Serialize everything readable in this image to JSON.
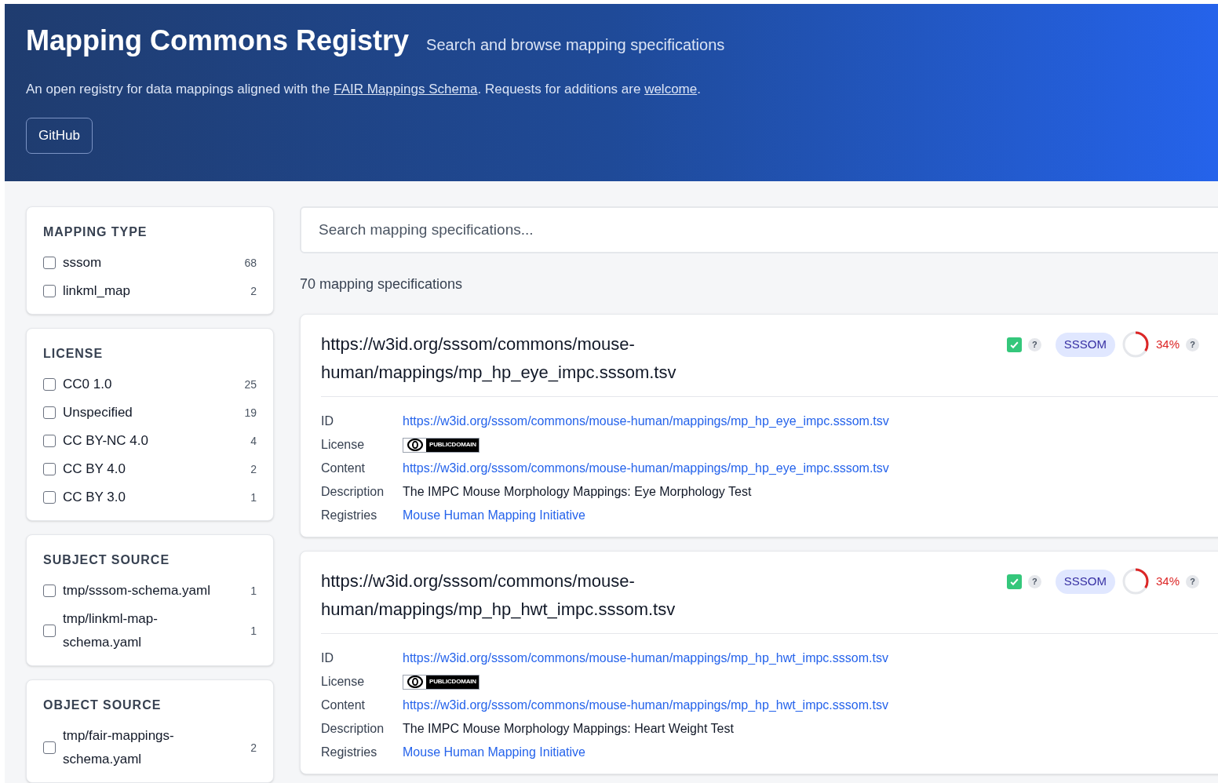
{
  "header": {
    "title": "Mapping Commons Registry",
    "subtitle": "Search and browse mapping specifications",
    "intro": [
      {
        "kind": "text",
        "text": "An open registry for data mappings aligned with the "
      },
      {
        "kind": "link",
        "text": "FAIR Mappings Schema"
      },
      {
        "kind": "text",
        "text": ". Requests for additions are "
      },
      {
        "kind": "link",
        "text": "welcome"
      },
      {
        "kind": "text",
        "text": "."
      }
    ],
    "button": "GitHub"
  },
  "filters": [
    {
      "title": "MAPPING TYPE",
      "options": [
        {
          "label": "sssom",
          "count": "68",
          "checked": false
        },
        {
          "label": "linkml_map",
          "count": "2",
          "checked": false
        }
      ]
    },
    {
      "title": "LICENSE",
      "options": [
        {
          "label": "CC0 1.0",
          "count": "25",
          "checked": false
        },
        {
          "label": "Unspecified",
          "count": "19",
          "checked": false
        },
        {
          "label": "CC BY-NC 4.0",
          "count": "4",
          "checked": false
        },
        {
          "label": "CC BY 4.0",
          "count": "2",
          "checked": false
        },
        {
          "label": "CC BY 3.0",
          "count": "1",
          "checked": false
        }
      ]
    },
    {
      "title": "SUBJECT SOURCE",
      "options": [
        {
          "label": "tmp/sssom-schema.yaml",
          "count": "1",
          "checked": false
        },
        {
          "label": "tmp/linkml-map-schema.yaml",
          "count": "1",
          "checked": false
        }
      ]
    },
    {
      "title": "OBJECT SOURCE",
      "options": [
        {
          "label": "tmp/fair-mappings-schema.yaml",
          "count": "2",
          "checked": false
        }
      ]
    }
  ],
  "search": {
    "placeholder": "Search mapping specifications..."
  },
  "result_count": "70 mapping specifications",
  "results": [
    {
      "title": "https://w3id.org/sssom/commons/mouse-human/mappings/mp_hp_eye_impc.sssom.tsv",
      "valid": true,
      "valid_help": "?",
      "format": "SSSOM",
      "completeness": {
        "level": 0.34,
        "reading": "34%",
        "help": "?"
      },
      "fields": [
        {
          "label": "ID",
          "kind": "link",
          "value": "https://w3id.org/sssom/commons/mouse-human/mappings/mp_hp_eye_impc.sssom.tsv"
        },
        {
          "label": "License",
          "kind": "license",
          "value": "PUBLICDOMAIN"
        },
        {
          "label": "Content",
          "kind": "link",
          "value": "https://w3id.org/sssom/commons/mouse-human/mappings/mp_hp_eye_impc.sssom.tsv"
        },
        {
          "label": "Description",
          "kind": "text",
          "value": "The IMPC Mouse Morphology Mappings: Eye Morphology Test"
        },
        {
          "label": "Registries",
          "kind": "link",
          "value": "Mouse Human Mapping Initiative"
        }
      ]
    },
    {
      "title": "https://w3id.org/sssom/commons/mouse-human/mappings/mp_hp_hwt_impc.sssom.tsv",
      "valid": true,
      "valid_help": "?",
      "format": "SSSOM",
      "completeness": {
        "level": 0.34,
        "reading": "34%",
        "help": "?"
      },
      "fields": [
        {
          "label": "ID",
          "kind": "link",
          "value": "https://w3id.org/sssom/commons/mouse-human/mappings/mp_hp_hwt_impc.sssom.tsv"
        },
        {
          "label": "License",
          "kind": "license",
          "value": "PUBLICDOMAIN"
        },
        {
          "label": "Content",
          "kind": "link",
          "value": "https://w3id.org/sssom/commons/mouse-human/mappings/mp_hp_hwt_impc.sssom.tsv"
        },
        {
          "label": "Description",
          "kind": "text",
          "value": "The IMPC Mouse Morphology Mappings: Heart Weight Test"
        },
        {
          "label": "Registries",
          "kind": "link",
          "value": "Mouse Human Mapping Initiative"
        }
      ]
    }
  ]
}
